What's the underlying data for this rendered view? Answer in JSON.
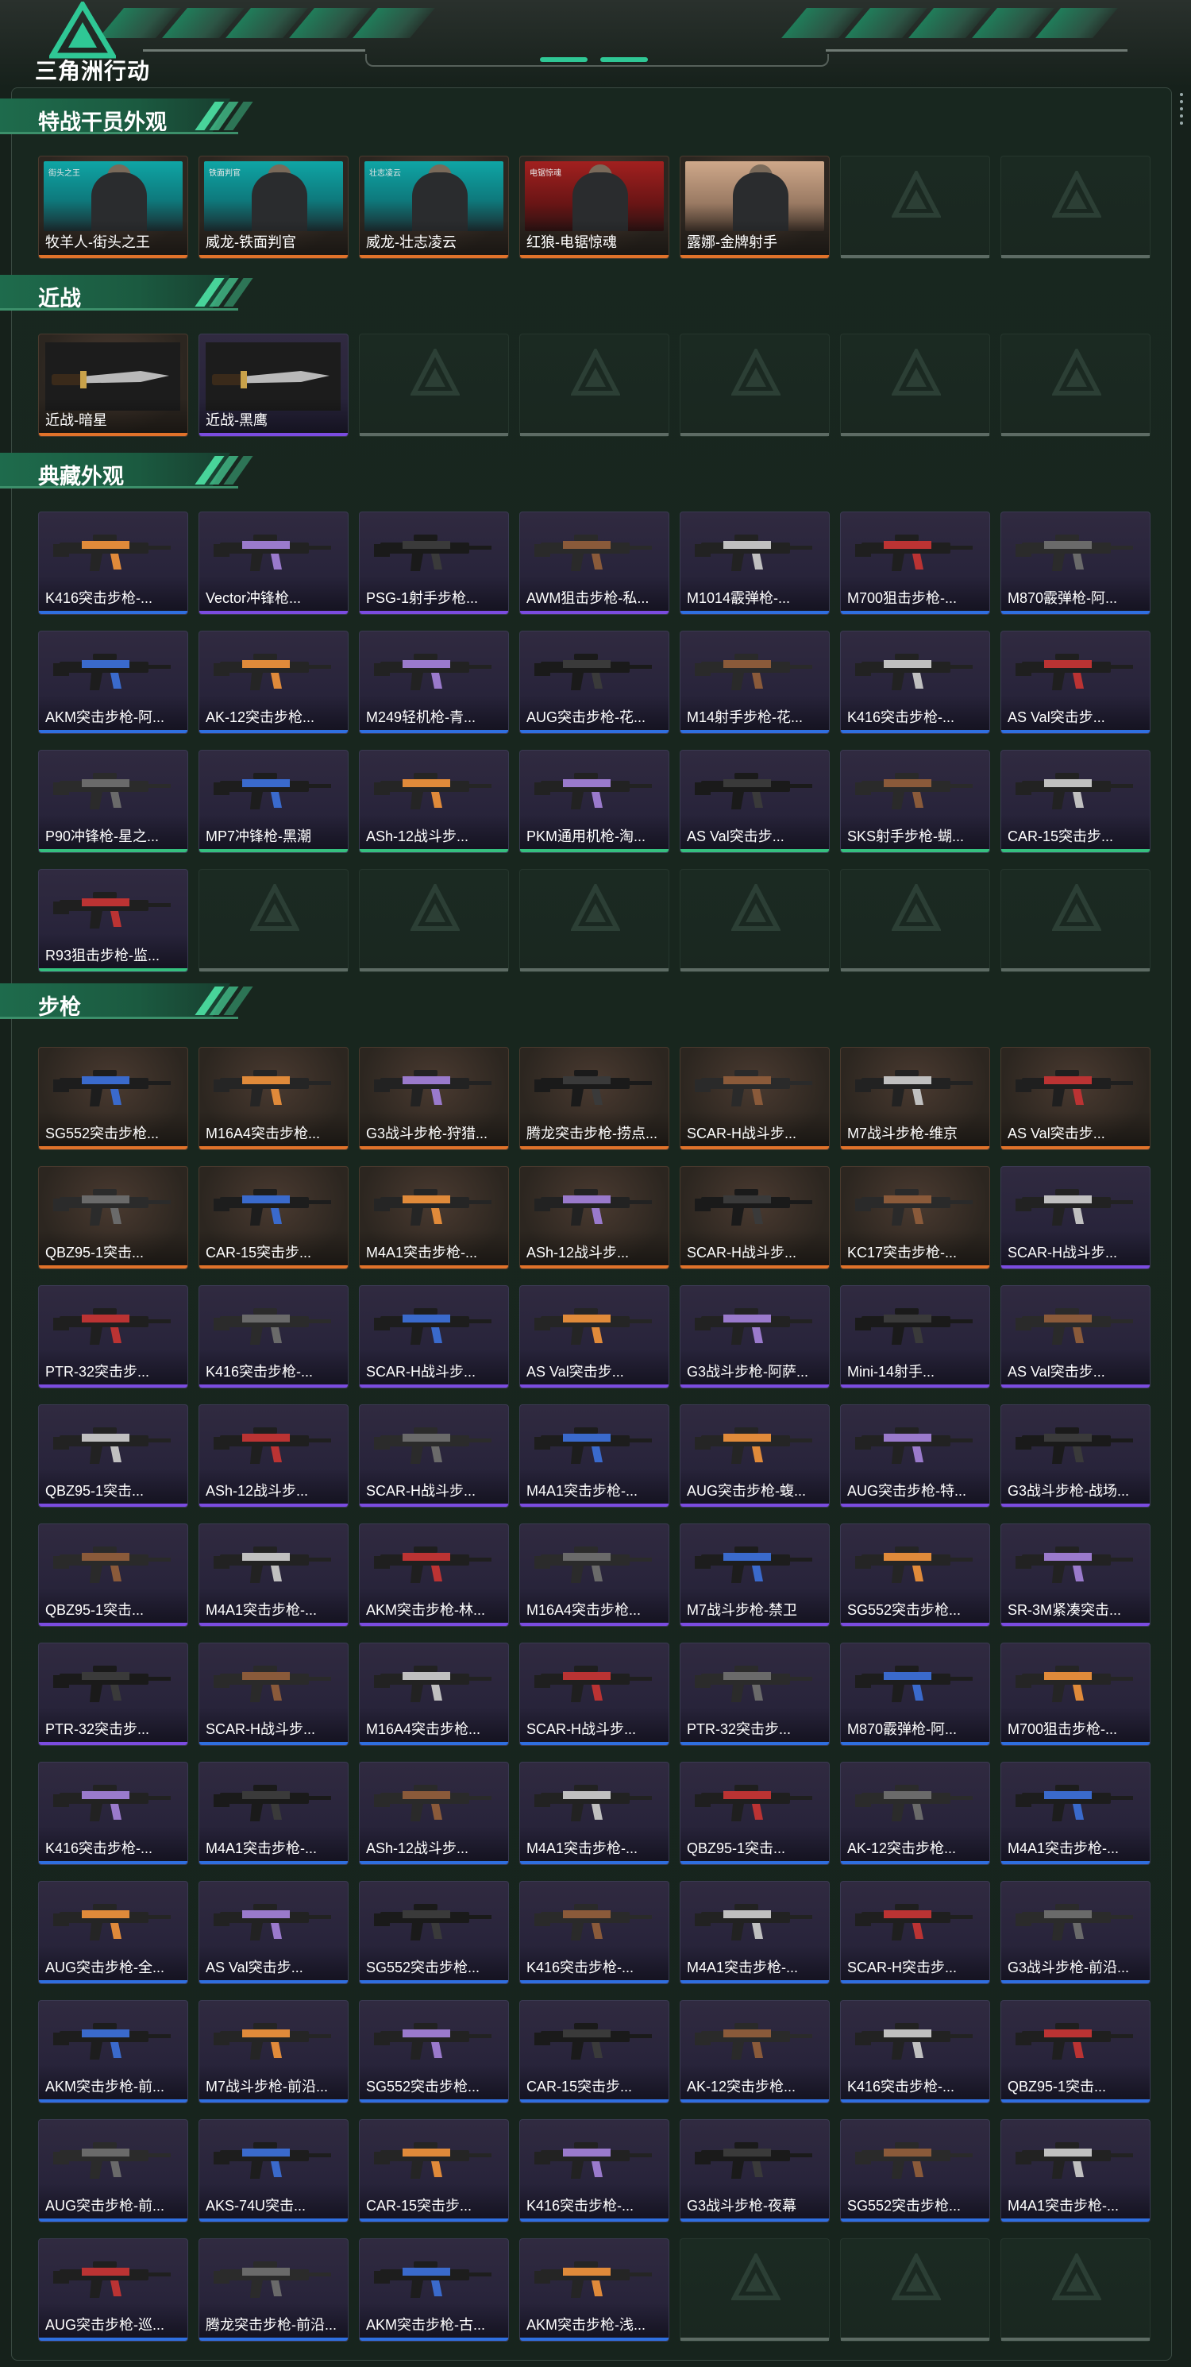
{
  "app": {
    "logo_text": "三角洲行动"
  },
  "colors": {
    "orange": "#e0722a",
    "purple": "#7b4ce0",
    "blue": "#2f6fe0",
    "green": "#35c07f",
    "accent": "#2fc795"
  },
  "sections": [
    {
      "title": "特战干员外观",
      "items": [
        {
          "name": "牧羊人-街头之王",
          "rarity": "orange",
          "kind": "operator",
          "banner": "街头之王"
        },
        {
          "name": "威龙-铁面判官",
          "rarity": "orange",
          "kind": "operator",
          "banner": "铁面判官"
        },
        {
          "name": "威龙-壮志凌云",
          "rarity": "orange",
          "kind": "operator",
          "banner": "壮志凌云"
        },
        {
          "name": "红狼-电锯惊魂",
          "rarity": "orange",
          "kind": "operator",
          "banner": "电锯惊魂"
        },
        {
          "name": "露娜-金牌射手",
          "rarity": "orange",
          "kind": "operator",
          "banner": ""
        },
        {
          "empty": true
        },
        {
          "empty": true
        }
      ]
    },
    {
      "title": "近战",
      "items": [
        {
          "name": "近战-暗星",
          "rarity": "orange",
          "kind": "knife"
        },
        {
          "name": "近战-黑鹰",
          "rarity": "purple",
          "kind": "knife"
        },
        {
          "empty": true
        },
        {
          "empty": true
        },
        {
          "empty": true
        },
        {
          "empty": true
        },
        {
          "empty": true
        }
      ]
    },
    {
      "title": "典藏外观",
      "items": [
        {
          "name": "K416突击步枪-...",
          "rarity": "blue"
        },
        {
          "name": "Vector冲锋枪...",
          "rarity": "purple"
        },
        {
          "name": "PSG-1射手步枪...",
          "rarity": "purple"
        },
        {
          "name": "AWM狙击步枪-私...",
          "rarity": "purple"
        },
        {
          "name": "M1014霰弹枪-...",
          "rarity": "blue"
        },
        {
          "name": "M700狙击步枪-...",
          "rarity": "blue"
        },
        {
          "name": "M870霰弹枪-阿...",
          "rarity": "blue"
        },
        {
          "name": "AKM突击步枪-阿...",
          "rarity": "blue"
        },
        {
          "name": "AK-12突击步枪...",
          "rarity": "blue"
        },
        {
          "name": "M249轻机枪-青...",
          "rarity": "blue"
        },
        {
          "name": "AUG突击步枪-花...",
          "rarity": "blue"
        },
        {
          "name": "M14射手步枪-花...",
          "rarity": "blue"
        },
        {
          "name": "K416突击步枪-...",
          "rarity": "blue"
        },
        {
          "name": "AS Val突击步...",
          "rarity": "blue"
        },
        {
          "name": "P90冲锋枪-星之...",
          "rarity": "green"
        },
        {
          "name": "MP7冲锋枪-黑潮",
          "rarity": "green"
        },
        {
          "name": "ASh-12战斗步...",
          "rarity": "green"
        },
        {
          "name": "PKM通用机枪-淘...",
          "rarity": "green"
        },
        {
          "name": "AS Val突击步...",
          "rarity": "green"
        },
        {
          "name": "SKS射手步枪-蝴...",
          "rarity": "green"
        },
        {
          "name": "CAR-15突击步...",
          "rarity": "green"
        },
        {
          "name": "R93狙击步枪-监...",
          "rarity": "green"
        },
        {
          "empty": true
        },
        {
          "empty": true
        },
        {
          "empty": true
        },
        {
          "empty": true
        },
        {
          "empty": true
        },
        {
          "empty": true
        }
      ]
    },
    {
      "title": "步枪",
      "items": [
        {
          "name": "SG552突击步枪...",
          "rarity": "orange"
        },
        {
          "name": "M16A4突击步枪...",
          "rarity": "orange"
        },
        {
          "name": "G3战斗步枪-狩猎...",
          "rarity": "orange"
        },
        {
          "name": "腾龙突击步枪-捞点...",
          "rarity": "orange"
        },
        {
          "name": "SCAR-H战斗步...",
          "rarity": "orange"
        },
        {
          "name": "M7战斗步枪-维京",
          "rarity": "orange"
        },
        {
          "name": "AS Val突击步...",
          "rarity": "orange"
        },
        {
          "name": "QBZ95-1突击...",
          "rarity": "orange"
        },
        {
          "name": "CAR-15突击步...",
          "rarity": "orange"
        },
        {
          "name": "M4A1突击步枪-...",
          "rarity": "orange"
        },
        {
          "name": "ASh-12战斗步...",
          "rarity": "orange"
        },
        {
          "name": "SCAR-H战斗步...",
          "rarity": "orange"
        },
        {
          "name": "KC17突击步枪-...",
          "rarity": "orange"
        },
        {
          "name": "SCAR-H战斗步...",
          "rarity": "purple"
        },
        {
          "name": "PTR-32突击步...",
          "rarity": "purple"
        },
        {
          "name": "K416突击步枪-...",
          "rarity": "purple"
        },
        {
          "name": "SCAR-H战斗步...",
          "rarity": "purple"
        },
        {
          "name": "AS Val突击步...",
          "rarity": "purple"
        },
        {
          "name": "G3战斗步枪-阿萨...",
          "rarity": "purple"
        },
        {
          "name": "Mini-14射手...",
          "rarity": "purple"
        },
        {
          "name": "AS Val突击步...",
          "rarity": "purple"
        },
        {
          "name": "QBZ95-1突击...",
          "rarity": "purple"
        },
        {
          "name": "ASh-12战斗步...",
          "rarity": "purple"
        },
        {
          "name": "SCAR-H战斗步...",
          "rarity": "purple"
        },
        {
          "name": "M4A1突击步枪-...",
          "rarity": "purple"
        },
        {
          "name": "AUG突击步枪-蝮...",
          "rarity": "purple"
        },
        {
          "name": "AUG突击步枪-特...",
          "rarity": "purple"
        },
        {
          "name": "G3战斗步枪-战场...",
          "rarity": "purple"
        },
        {
          "name": "QBZ95-1突击...",
          "rarity": "purple"
        },
        {
          "name": "M4A1突击步枪-...",
          "rarity": "purple"
        },
        {
          "name": "AKM突击步枪-林...",
          "rarity": "purple"
        },
        {
          "name": "M16A4突击步枪...",
          "rarity": "purple"
        },
        {
          "name": "M7战斗步枪-禁卫",
          "rarity": "purple"
        },
        {
          "name": "SG552突击步枪...",
          "rarity": "purple"
        },
        {
          "name": "SR-3M紧凑突击...",
          "rarity": "purple"
        },
        {
          "name": "PTR-32突击步...",
          "rarity": "purple"
        },
        {
          "name": "SCAR-H战斗步...",
          "rarity": "blue"
        },
        {
          "name": "M16A4突击步枪...",
          "rarity": "blue"
        },
        {
          "name": "SCAR-H战斗步...",
          "rarity": "blue"
        },
        {
          "name": "PTR-32突击步...",
          "rarity": "blue"
        },
        {
          "name": "M870霰弹枪-阿...",
          "rarity": "blue"
        },
        {
          "name": "M700狙击步枪-...",
          "rarity": "blue"
        },
        {
          "name": "K416突击步枪-...",
          "rarity": "blue"
        },
        {
          "name": "M4A1突击步枪-...",
          "rarity": "blue"
        },
        {
          "name": "ASh-12战斗步...",
          "rarity": "blue"
        },
        {
          "name": "M4A1突击步枪-...",
          "rarity": "blue"
        },
        {
          "name": "QBZ95-1突击...",
          "rarity": "blue"
        },
        {
          "name": "AK-12突击步枪...",
          "rarity": "blue"
        },
        {
          "name": "M4A1突击步枪-...",
          "rarity": "blue"
        },
        {
          "name": "AUG突击步枪-全...",
          "rarity": "blue"
        },
        {
          "name": "AS Val突击步...",
          "rarity": "blue"
        },
        {
          "name": "SG552突击步枪...",
          "rarity": "blue"
        },
        {
          "name": "K416突击步枪-...",
          "rarity": "blue"
        },
        {
          "name": "M4A1突击步枪-...",
          "rarity": "blue"
        },
        {
          "name": "SCAR-H突击步...",
          "rarity": "blue"
        },
        {
          "name": "G3战斗步枪-前沿...",
          "rarity": "blue"
        },
        {
          "name": "AKM突击步枪-前...",
          "rarity": "blue"
        },
        {
          "name": "M7战斗步枪-前沿...",
          "rarity": "blue"
        },
        {
          "name": "SG552突击步枪...",
          "rarity": "blue"
        },
        {
          "name": "CAR-15突击步...",
          "rarity": "blue"
        },
        {
          "name": "AK-12突击步枪...",
          "rarity": "blue"
        },
        {
          "name": "K416突击步枪-...",
          "rarity": "blue"
        },
        {
          "name": "QBZ95-1突击...",
          "rarity": "blue"
        },
        {
          "name": "AUG突击步枪-前...",
          "rarity": "blue"
        },
        {
          "name": "AKS-74U突击...",
          "rarity": "blue"
        },
        {
          "name": "CAR-15突击步...",
          "rarity": "blue"
        },
        {
          "name": "K416突击步枪-...",
          "rarity": "blue"
        },
        {
          "name": "G3战斗步枪-夜幕",
          "rarity": "blue"
        },
        {
          "name": "SG552突击步枪...",
          "rarity": "blue"
        },
        {
          "name": "M4A1突击步枪-...",
          "rarity": "blue"
        },
        {
          "name": "AUG突击步枪-巡...",
          "rarity": "blue"
        },
        {
          "name": "腾龙突击步枪-前沿...",
          "rarity": "blue"
        },
        {
          "name": "AKM突击步枪-古...",
          "rarity": "blue"
        },
        {
          "name": "AKM突击步枪-浅...",
          "rarity": "blue"
        },
        {
          "empty": true
        },
        {
          "empty": true
        },
        {
          "empty": true
        }
      ]
    }
  ]
}
